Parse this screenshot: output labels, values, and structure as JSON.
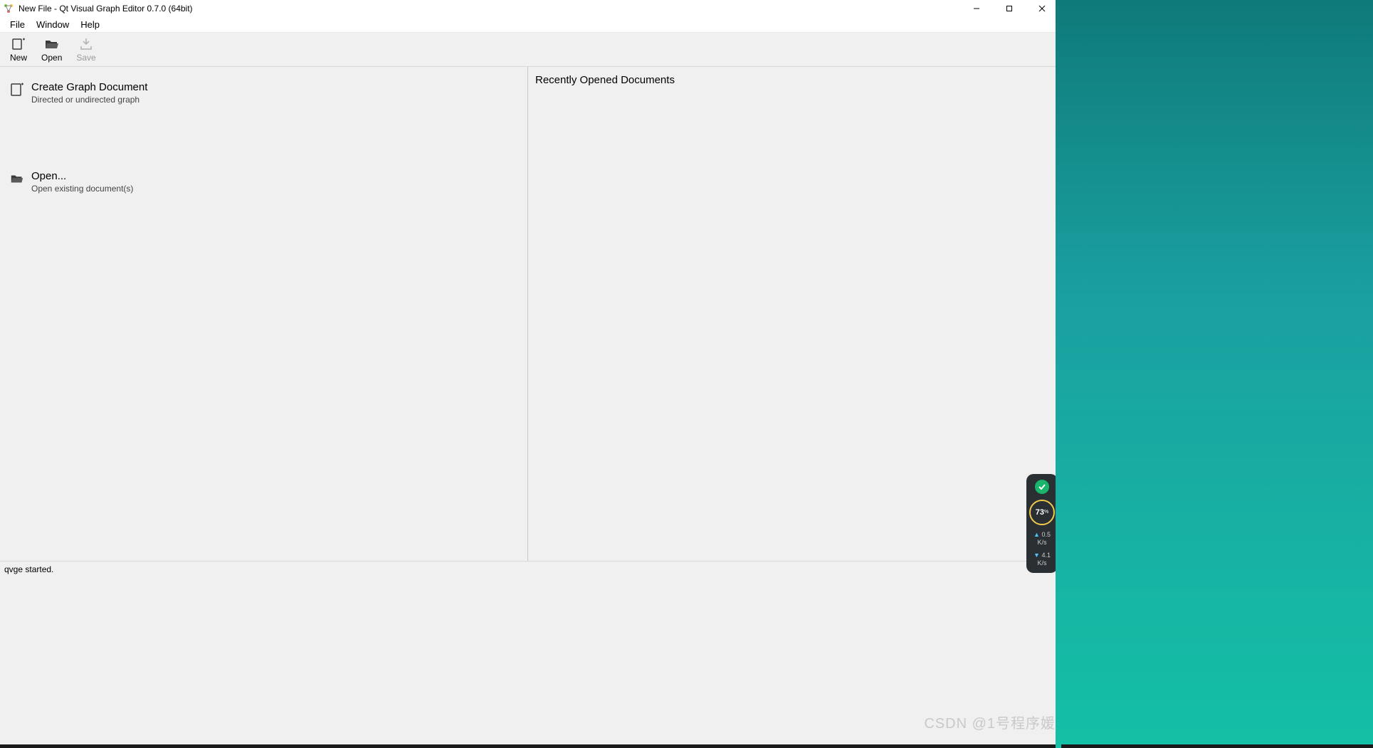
{
  "window": {
    "title": "New File - Qt Visual Graph Editor 0.7.0 (64bit)"
  },
  "menubar": {
    "items": [
      "File",
      "Window",
      "Help"
    ]
  },
  "toolbar": {
    "new_label": "New",
    "open_label": "Open",
    "save_label": "Save"
  },
  "left_panel": {
    "create": {
      "title": "Create Graph Document",
      "subtitle": "Directed or undirected graph"
    },
    "open": {
      "title": "Open...",
      "subtitle": "Open existing document(s)"
    }
  },
  "right_panel": {
    "header": "Recently Opened Documents"
  },
  "statusbar": {
    "text": "qvge started."
  },
  "widget": {
    "percent": "73",
    "percent_unit": "%",
    "up_speed": "0.5",
    "up_unit": "K/s",
    "down_speed": "4.1",
    "down_unit": "K/s"
  },
  "watermark": "CSDN @1号程序媛"
}
